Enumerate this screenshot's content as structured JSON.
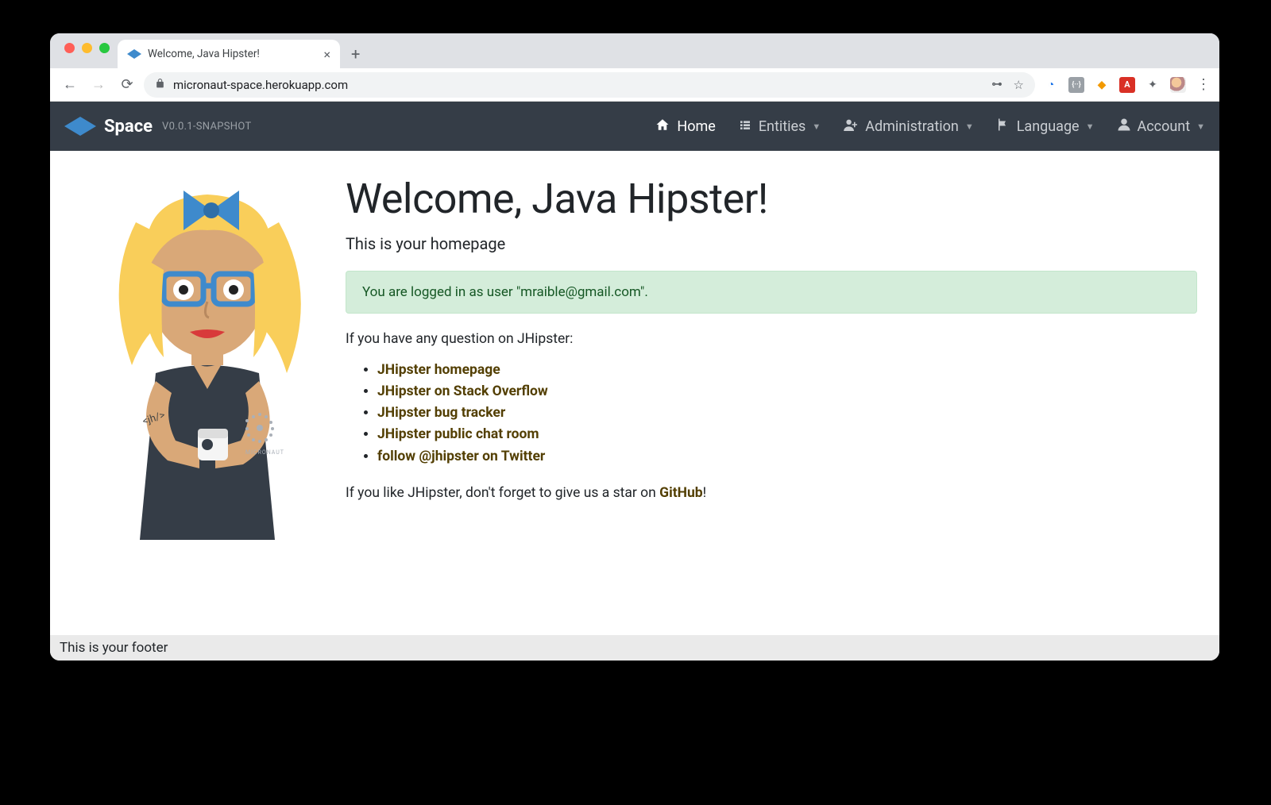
{
  "browser": {
    "tab_title": "Welcome, Java Hipster!",
    "url": "micronaut-space.herokuapp.com"
  },
  "brand": {
    "name": "Space",
    "version": "v0.0.1-SNAPSHOT"
  },
  "nav": {
    "home": "Home",
    "entities": "Entities",
    "administration": "Administration",
    "language": "Language",
    "account": "Account"
  },
  "page": {
    "heading": "Welcome, Java Hipster!",
    "subtitle": "This is your homepage",
    "logged_in_message": "You are logged in as user \"mraible@gmail.com\".",
    "question": "If you have any question on JHipster:",
    "links": [
      "JHipster homepage",
      "JHipster on Stack Overflow",
      "JHipster bug tracker",
      "JHipster public chat room",
      "follow @jhipster on Twitter"
    ],
    "star_prefix": "If you like JHipster, don't forget to give us a star on ",
    "star_link": "GitHub",
    "star_suffix": "!"
  },
  "footer": "This is your footer"
}
